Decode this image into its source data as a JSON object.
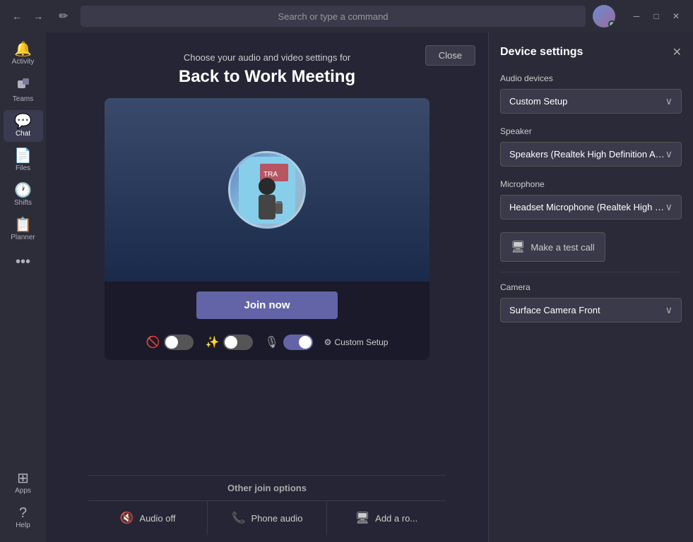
{
  "titleBar": {
    "searchPlaceholder": "Search or type a command",
    "minimize": "─",
    "maximize": "□",
    "close": "✕"
  },
  "sidebar": {
    "items": [
      {
        "id": "activity",
        "label": "Activity",
        "icon": "🔔"
      },
      {
        "id": "teams",
        "label": "Teams",
        "icon": "⊞"
      },
      {
        "id": "chat",
        "label": "Chat",
        "icon": "💬",
        "active": true
      },
      {
        "id": "files",
        "label": "Files",
        "icon": "📄"
      },
      {
        "id": "shifts",
        "label": "Shifts",
        "icon": "🕐"
      },
      {
        "id": "planner",
        "label": "Planner",
        "icon": "📋"
      }
    ],
    "bottom": [
      {
        "id": "help",
        "label": "Help",
        "icon": "?"
      },
      {
        "id": "apps",
        "label": "Apps",
        "icon": "⊞"
      },
      {
        "id": "help2",
        "label": "Help",
        "icon": "?"
      }
    ],
    "dots": "•••"
  },
  "meeting": {
    "closeLabel": "Close",
    "subtitle": "Choose your audio and video settings for",
    "title": "Back to Work Meeting",
    "joinLabel": "Join now",
    "controls": {
      "customSetupLabel": "Custom Setup",
      "gearIcon": "⚙"
    },
    "otherOptions": {
      "label": "Other join options",
      "items": [
        {
          "id": "audio-off",
          "icon": "🔇",
          "label": "Audio off"
        },
        {
          "id": "phone-audio",
          "icon": "📞",
          "label": "Phone audio"
        },
        {
          "id": "add-room",
          "icon": "🖥",
          "label": "Add a ro..."
        }
      ]
    }
  },
  "deviceSettings": {
    "title": "Device settings",
    "closeIcon": "✕",
    "audioDevicesLabel": "Audio devices",
    "audioDevicesValue": "Custom Setup",
    "speakerLabel": "Speaker",
    "speakerValue": "Speakers (Realtek High Definition Au...",
    "microphoneLabel": "Microphone",
    "microphoneValue": "Headset Microphone (Realtek High D...",
    "makeTestCallIcon": "🖥",
    "makeTestCallLabel": "Make a test call",
    "cameraLabel": "Camera",
    "cameraValue": "Surface Camera Front"
  }
}
